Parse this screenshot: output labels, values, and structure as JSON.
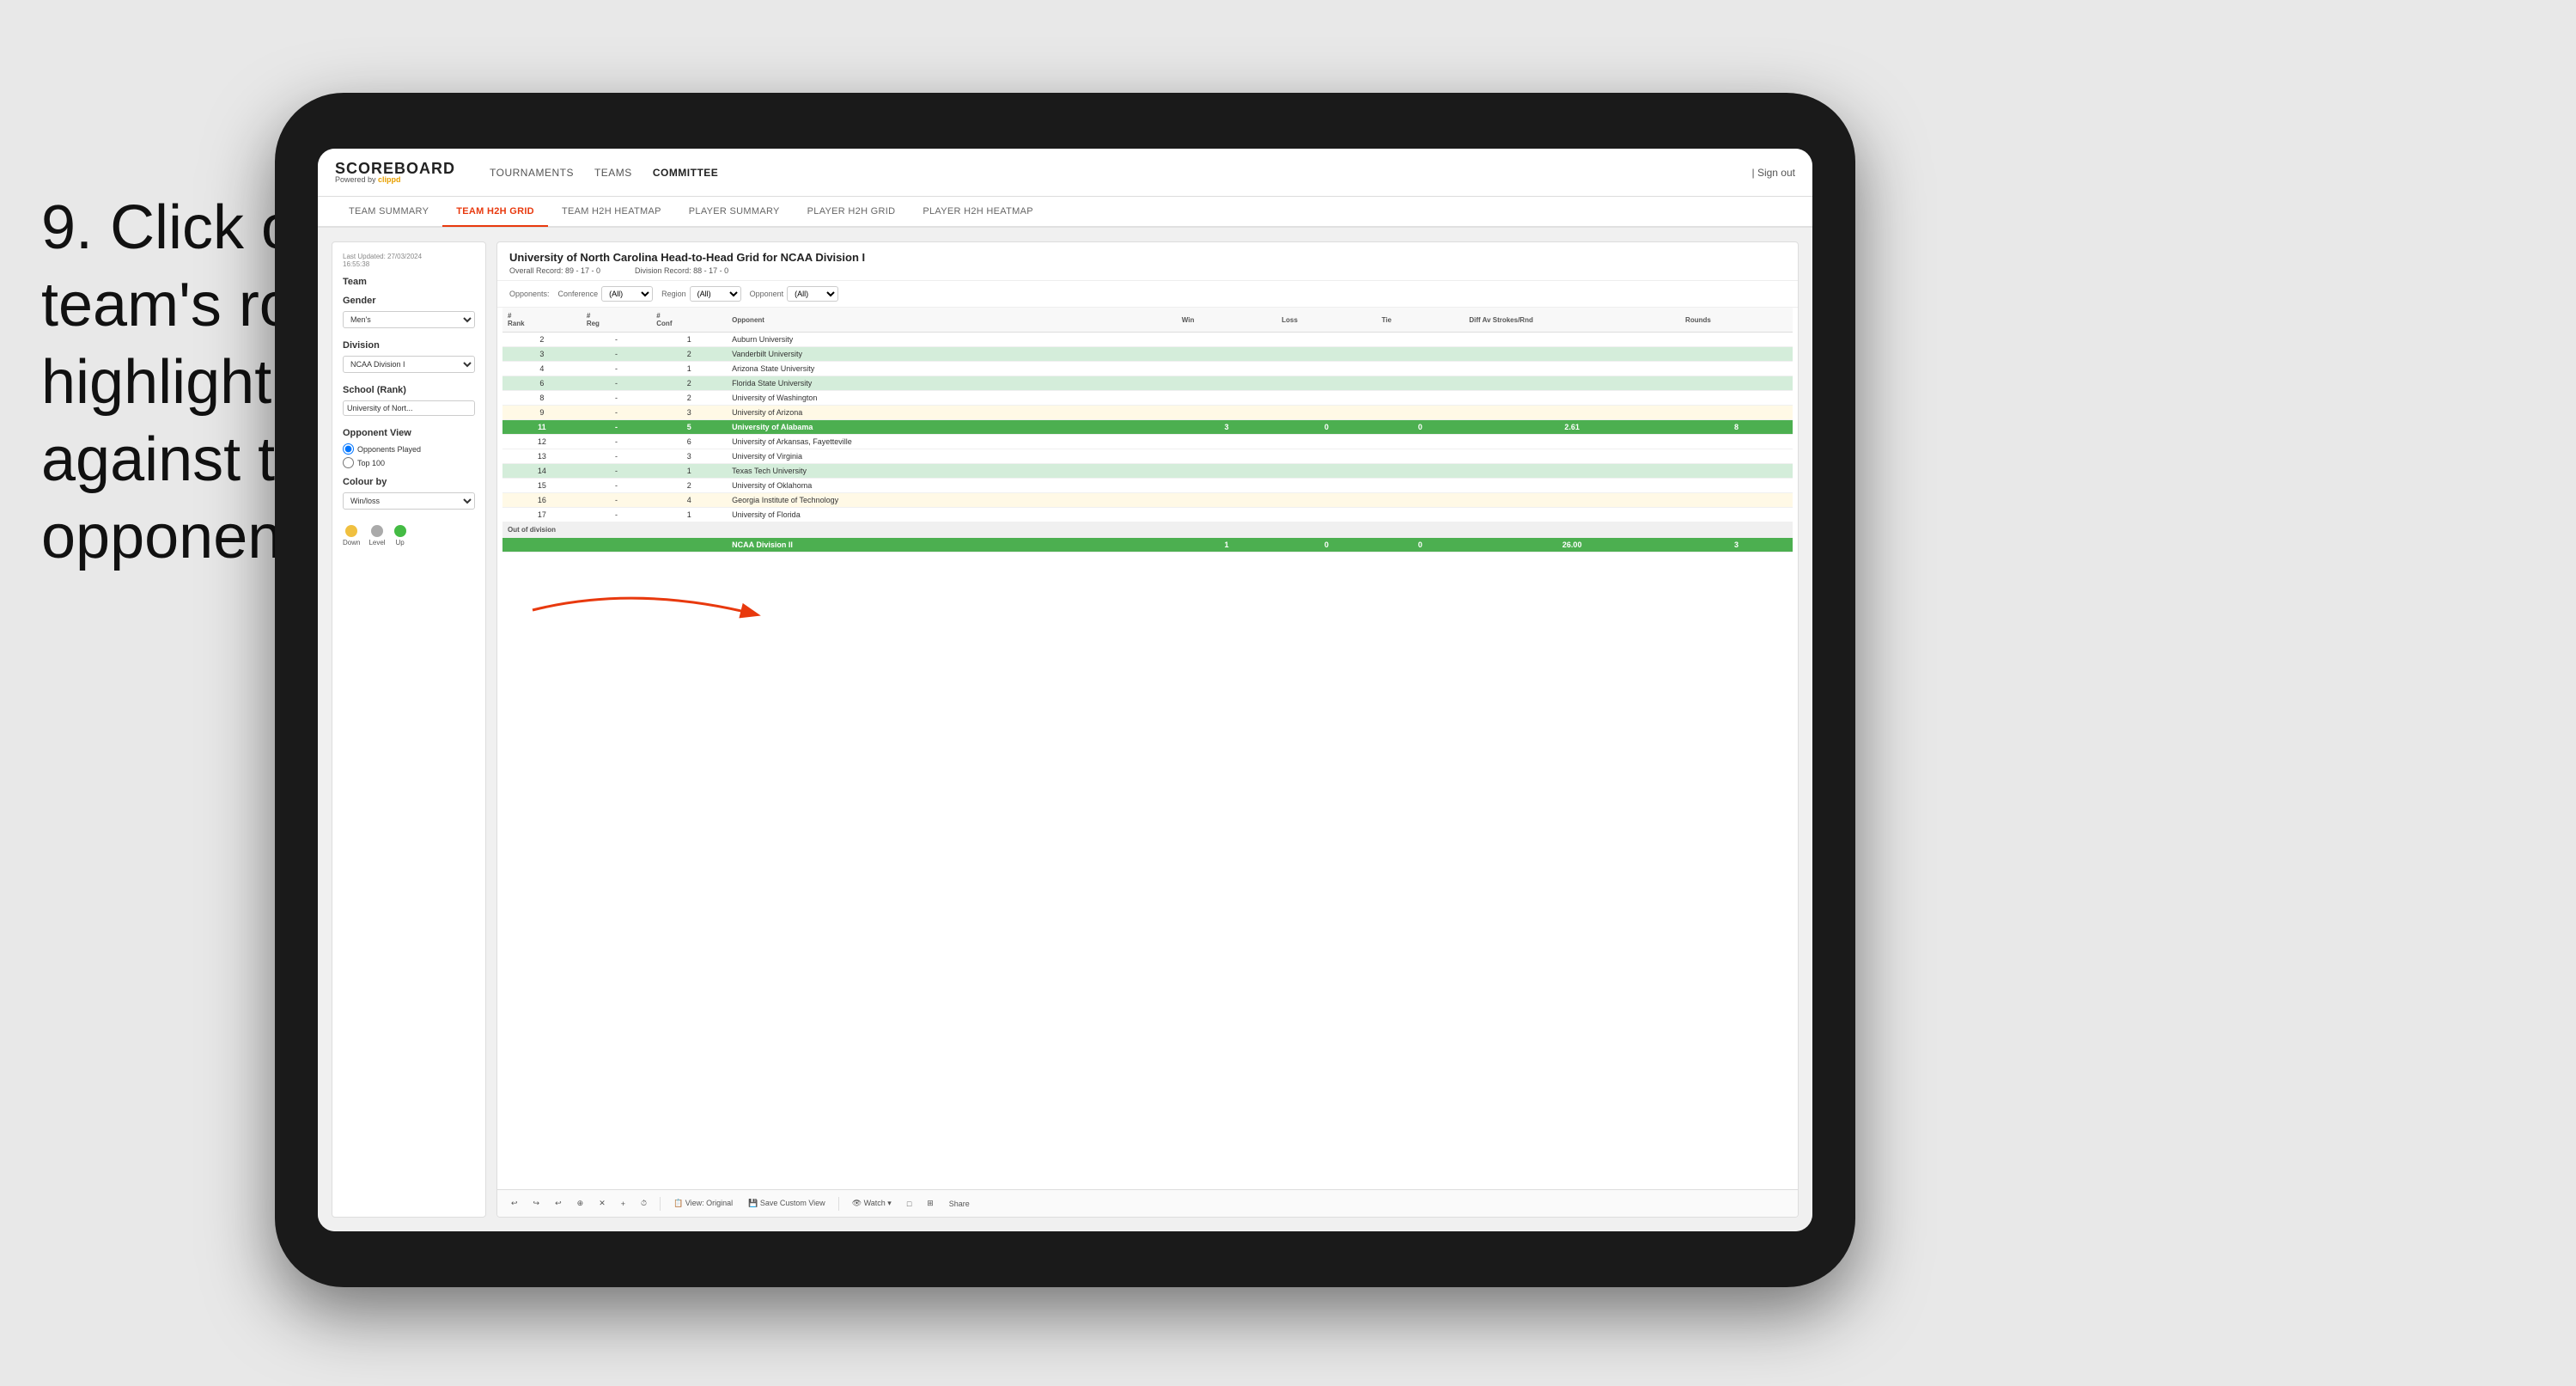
{
  "instruction": {
    "step": "9.",
    "text": "Click on a team's row to highlight results against that opponent"
  },
  "nav": {
    "logo_title": "SCOREBOARD",
    "logo_subtitle": "Powered by",
    "logo_brand": "clippd",
    "links": [
      "TOURNAMENTS",
      "TEAMS",
      "COMMITTEE"
    ],
    "sign_out": "Sign out"
  },
  "sub_nav": {
    "items": [
      "TEAM SUMMARY",
      "TEAM H2H GRID",
      "TEAM H2H HEATMAP",
      "PLAYER SUMMARY",
      "PLAYER H2H GRID",
      "PLAYER H2H HEATMAP"
    ],
    "active": "TEAM H2H GRID"
  },
  "left_panel": {
    "timestamp": "Last Updated: 27/03/2024",
    "time": "16:55:38",
    "team_label": "Team",
    "gender_label": "Gender",
    "gender_value": "Men's",
    "division_label": "Division",
    "division_value": "NCAA Division I",
    "school_label": "School (Rank)",
    "school_value": "University of Nort...",
    "opponent_view_label": "Opponent View",
    "radio1": "Opponents Played",
    "radio2": "Top 100",
    "colour_by_label": "Colour by",
    "colour_by_value": "Win/loss",
    "legend": [
      {
        "label": "Down",
        "color": "#f0c040"
      },
      {
        "label": "Level",
        "color": "#aaaaaa"
      },
      {
        "label": "Up",
        "color": "#44bb44"
      }
    ]
  },
  "grid": {
    "title": "University of North Carolina Head-to-Head Grid for NCAA Division I",
    "overall_record": "Overall Record: 89 - 17 - 0",
    "division_record": "Division Record: 88 - 17 - 0",
    "filters": {
      "opponents_label": "Opponents:",
      "conference_label": "Conference",
      "conference_value": "(All)",
      "region_label": "Region",
      "region_value": "(All)",
      "opponent_label": "Opponent",
      "opponent_value": "(All)"
    },
    "columns": [
      "# Rank",
      "# Reg",
      "# Conf",
      "Opponent",
      "Win",
      "Loss",
      "Tie",
      "Diff Av Strokes/Rnd",
      "Rounds"
    ],
    "rows": [
      {
        "rank": "2",
        "reg": "-",
        "conf": "1",
        "opponent": "Auburn University",
        "win": "",
        "loss": "",
        "tie": "",
        "diff": "",
        "rounds": "",
        "style": "normal"
      },
      {
        "rank": "3",
        "reg": "-",
        "conf": "2",
        "opponent": "Vanderbilt University",
        "win": "",
        "loss": "",
        "tie": "",
        "diff": "",
        "rounds": "",
        "style": "light-green"
      },
      {
        "rank": "4",
        "reg": "-",
        "conf": "1",
        "opponent": "Arizona State University",
        "win": "",
        "loss": "",
        "tie": "",
        "diff": "",
        "rounds": "",
        "style": "normal"
      },
      {
        "rank": "6",
        "reg": "-",
        "conf": "2",
        "opponent": "Florida State University",
        "win": "",
        "loss": "",
        "tie": "",
        "diff": "",
        "rounds": "",
        "style": "light-green"
      },
      {
        "rank": "8",
        "reg": "-",
        "conf": "2",
        "opponent": "University of Washington",
        "win": "",
        "loss": "",
        "tie": "",
        "diff": "",
        "rounds": "",
        "style": "normal"
      },
      {
        "rank": "9",
        "reg": "-",
        "conf": "3",
        "opponent": "University of Arizona",
        "win": "",
        "loss": "",
        "tie": "",
        "diff": "",
        "rounds": "",
        "style": "light-yellow"
      },
      {
        "rank": "11",
        "reg": "-",
        "conf": "5",
        "opponent": "University of Alabama",
        "win": "3",
        "loss": "0",
        "tie": "0",
        "diff": "2.61",
        "rounds": "8",
        "style": "selected"
      },
      {
        "rank": "12",
        "reg": "-",
        "conf": "6",
        "opponent": "University of Arkansas, Fayetteville",
        "win": "",
        "loss": "",
        "tie": "",
        "diff": "",
        "rounds": "",
        "style": "normal"
      },
      {
        "rank": "13",
        "reg": "-",
        "conf": "3",
        "opponent": "University of Virginia",
        "win": "",
        "loss": "",
        "tie": "",
        "diff": "",
        "rounds": "",
        "style": "normal"
      },
      {
        "rank": "14",
        "reg": "-",
        "conf": "1",
        "opponent": "Texas Tech University",
        "win": "",
        "loss": "",
        "tie": "",
        "diff": "",
        "rounds": "",
        "style": "light-green"
      },
      {
        "rank": "15",
        "reg": "-",
        "conf": "2",
        "opponent": "University of Oklahoma",
        "win": "",
        "loss": "",
        "tie": "",
        "diff": "",
        "rounds": "",
        "style": "normal"
      },
      {
        "rank": "16",
        "reg": "-",
        "conf": "4",
        "opponent": "Georgia Institute of Technology",
        "win": "",
        "loss": "",
        "tie": "",
        "diff": "",
        "rounds": "",
        "style": "light-yellow"
      },
      {
        "rank": "17",
        "reg": "-",
        "conf": "1",
        "opponent": "University of Florida",
        "win": "",
        "loss": "",
        "tie": "",
        "diff": "",
        "rounds": "",
        "style": "normal"
      }
    ],
    "out_of_division_label": "Out of division",
    "out_of_division_row": {
      "label": "NCAA Division II",
      "win": "1",
      "loss": "0",
      "tie": "0",
      "diff": "26.00",
      "rounds": "3"
    }
  },
  "toolbar": {
    "buttons": [
      "↩",
      "↪",
      "↩",
      "⊕",
      "✕",
      "+",
      "⏱",
      "View: Original",
      "Save Custom View",
      "👁 Watch ▾",
      "□",
      "⊞",
      "Share"
    ]
  }
}
